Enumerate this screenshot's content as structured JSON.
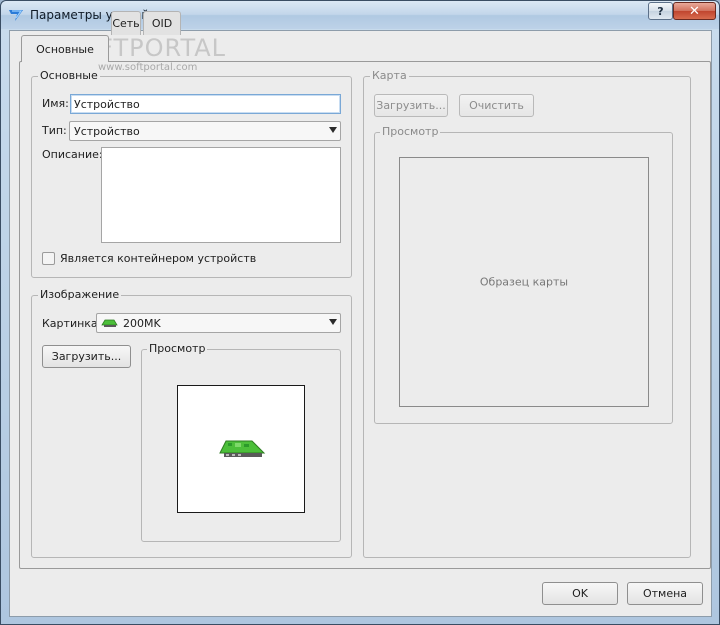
{
  "window": {
    "title": "Параметры устройства",
    "help_label": "?",
    "close_label": "✕"
  },
  "tabs": [
    {
      "label": "Основные",
      "active": true
    },
    {
      "label": "Сеть",
      "active": false
    },
    {
      "label": "OID",
      "active": false
    }
  ],
  "watermark": {
    "brand": "SOFTPORTAL",
    "url": "www.softportal.com"
  },
  "basic": {
    "legend": "Основные",
    "name_label": "Имя:",
    "name_value": "Устройство",
    "type_label": "Тип:",
    "type_value": "Устройство",
    "description_label": "Описание:",
    "container_label": "Является контейнером устройств",
    "container_checked": false
  },
  "image": {
    "legend": "Изображение",
    "picture_label": "Картинка",
    "picture_value": "200MK",
    "load_label": "Загрузить...",
    "preview_legend": "Просмотр"
  },
  "map": {
    "legend": "Карта",
    "load_label": "Загрузить...",
    "clear_label": "Очистить",
    "preview_legend": "Просмотр",
    "sample_text": "Образец карты"
  },
  "footer": {
    "ok_label": "OK",
    "cancel_label": "Отмена"
  },
  "colors": {
    "device_icon_green": "#4cbf3a",
    "focus_border": "#7aa8d6"
  }
}
